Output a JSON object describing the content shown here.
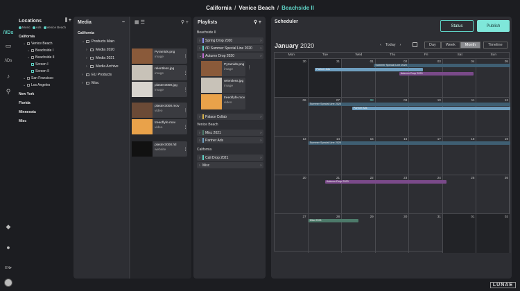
{
  "breadcrumb": [
    "California",
    "Venice Beach",
    "Beachside II"
  ],
  "rail": {
    "logo": "/\\/Ds",
    "lang": "EN"
  },
  "locations": {
    "title": "Locations",
    "filters": [
      "Music",
      "Ads",
      "Venice Beach"
    ],
    "items": [
      {
        "label": "California",
        "level": 0,
        "kind": "group"
      },
      {
        "label": "Venice Beach",
        "level": 1,
        "kind": "folder"
      },
      {
        "label": "Beachside I",
        "level": 2,
        "kind": "folder"
      },
      {
        "label": "Beachside II",
        "level": 2,
        "kind": "folder"
      },
      {
        "label": "Screen I",
        "level": 3,
        "kind": "screen"
      },
      {
        "label": "Screen II",
        "level": 3,
        "kind": "screen"
      },
      {
        "label": "San Francisco",
        "level": 1,
        "kind": "folder"
      },
      {
        "label": "Los Angeles",
        "level": 1,
        "kind": "folder"
      },
      {
        "label": "New York",
        "level": 0,
        "kind": "group"
      },
      {
        "label": "Florida",
        "level": 0,
        "kind": "group"
      },
      {
        "label": "Minnesota",
        "level": 0,
        "kind": "group"
      },
      {
        "label": "Misc",
        "level": 0,
        "kind": "group"
      }
    ]
  },
  "media": {
    "title": "Media",
    "tree": [
      {
        "label": "California",
        "level": 0
      },
      {
        "label": "Products Main",
        "level": 1
      },
      {
        "label": "Media 2020",
        "level": 2
      },
      {
        "label": "Media 2021",
        "level": 2
      },
      {
        "label": "Media Archive",
        "level": 2
      },
      {
        "label": "EU Products",
        "level": 1
      },
      {
        "label": "Misc",
        "level": 1
      }
    ],
    "files": [
      {
        "name": "Pyramids.png",
        "kind": "image",
        "thumb": "#8a5a3a"
      },
      {
        "name": "relentless.jpg",
        "kind": "image",
        "thumb": "#c8c2b8"
      },
      {
        "name": "plaster3000.jpg",
        "kind": "image",
        "thumb": "#d8d4ce"
      },
      {
        "name": "plaster3000.mov",
        "kind": "video",
        "thumb": "#6b4a36"
      },
      {
        "name": "treeoflyfe.mov",
        "kind": "video",
        "thumb": "#e9a24a"
      },
      {
        "name": "plaster3000.htl",
        "kind": "website",
        "thumb": "#111111"
      }
    ]
  },
  "playlists": {
    "title": "Playlists",
    "sec1": "Beachside II",
    "sec2": "Venice Beach",
    "sec3": "California",
    "items": [
      {
        "label": "Spring Drop 2020",
        "color": "#8d8ef0"
      },
      {
        "label": "/\\D Summer Special Line 2020",
        "color": "#5fd3c6"
      },
      {
        "label": "Autumn Drop 2020",
        "color": "#c06bd0"
      }
    ],
    "cards": [
      {
        "name": "Pyramids.png",
        "kind": "image",
        "thumb": "#8a5a3a"
      },
      {
        "name": "relentless.jpg",
        "kind": "image",
        "thumb": "#c8c2b8"
      },
      {
        "name": "treeoflyfe.mov",
        "kind": "video",
        "thumb": "#e9a24a"
      }
    ],
    "palace": "Palace Collab",
    "venice_items": [
      "Misc 2021",
      "Partner Ads"
    ],
    "cal_items": [
      "Cali Drop 2021",
      "Misc"
    ]
  },
  "scheduler": {
    "title": "Scheduler",
    "status": "Status",
    "publish": "Publish",
    "month": "January",
    "year": "2020",
    "today": "Today",
    "views": [
      "Day",
      "Week",
      "Month"
    ],
    "timeline": "Timeline",
    "dow": [
      "Mon",
      "Tue",
      "Wed",
      "Thu",
      "Fri",
      "Sat",
      "Sun"
    ],
    "weeks": [
      [
        "30",
        "31",
        "01",
        "02",
        "03",
        "04",
        "05"
      ],
      [
        "06",
        "07",
        "08",
        "09",
        "10",
        "11",
        "12"
      ],
      [
        "13",
        "14",
        "15",
        "16",
        "17",
        "18",
        "19"
      ],
      [
        "20",
        "21",
        "22",
        "23",
        "24",
        "25",
        "26"
      ],
      [
        "27",
        "28",
        "29",
        "30",
        "31",
        "01",
        "02"
      ]
    ],
    "events": [
      {
        "week": 0,
        "label": "Summer Special Line 2020",
        "start": 2.95,
        "end": 7,
        "row": 0,
        "color": "#3f5f73"
      },
      {
        "week": 0,
        "label": "Partner Ads",
        "start": 1.2,
        "end": 4.4,
        "row": 1,
        "color": "#6f9fc0"
      },
      {
        "week": 0,
        "label": "Autumn Drop 2020",
        "start": 3.7,
        "end": 5.9,
        "row": 2,
        "color": "#7a4a8a"
      },
      {
        "week": 1,
        "label": "Summer Special Line 2020",
        "start": 1,
        "end": 7,
        "row": 0,
        "color": "#3f5f73"
      },
      {
        "week": 1,
        "label": "Partner Ads",
        "start": 2.3,
        "end": 7,
        "row": 1,
        "color": "#6f9fc0"
      },
      {
        "week": 2,
        "label": "Summer Special Line 2020",
        "start": 1,
        "end": 7,
        "row": 0,
        "color": "#3f5f73"
      },
      {
        "week": 3,
        "label": "Autumn Drop 2020",
        "start": 1.5,
        "end": 5.1,
        "row": 0,
        "color": "#7a4a8a"
      },
      {
        "week": 4,
        "label": "Misc 2021",
        "start": 1,
        "end": 2.5,
        "row": 0,
        "color": "#4d7a6a"
      }
    ]
  },
  "brand": "LUNAE"
}
